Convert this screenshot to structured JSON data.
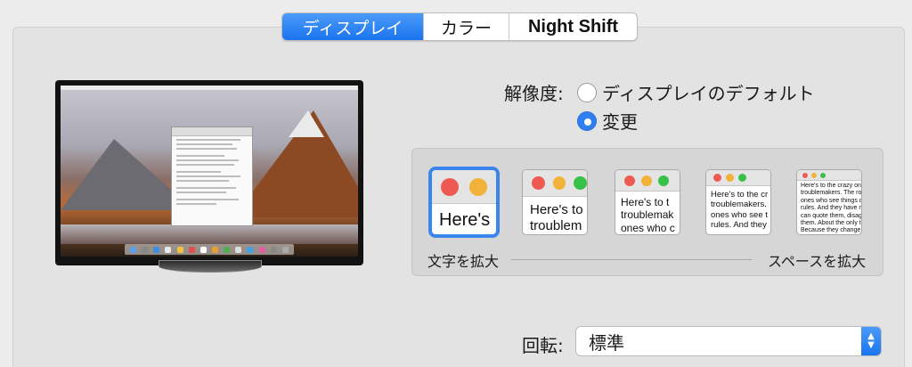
{
  "tabs": [
    {
      "label": "ディスプレイ",
      "active": true
    },
    {
      "label": "カラー",
      "active": false
    },
    {
      "label": "Night Shift",
      "active": false
    }
  ],
  "resolution": {
    "label": "解像度:",
    "options": [
      {
        "label": "ディスプレイのデフォルト",
        "selected": false
      },
      {
        "label": "変更",
        "selected": true
      }
    ]
  },
  "scaling": {
    "selected_index": 0,
    "thumbnails": [
      {
        "text": "Here's"
      },
      {
        "text": "Here's to\ntroublem"
      },
      {
        "text": "Here's to t\ntroublemak\nones who c"
      },
      {
        "text": "Here's to the cr\ntroublemakers.\nones who see t\nrules. And they"
      },
      {
        "text": "Here's to the crazy one\ntroublemakers. The rou\nones who see things di\nrules. And they have no\ncan quote them, disagr\nthem. About the only th\nBecause they change t"
      }
    ],
    "left_label": "文字を拡大",
    "right_label": "スペースを拡大"
  },
  "rotation": {
    "label": "回転:",
    "value": "標準"
  },
  "colors": {
    "accent": "#2f7ff1",
    "window_red": "#ee5a52",
    "window_yellow": "#f2b23a",
    "window_green": "#38c149"
  }
}
